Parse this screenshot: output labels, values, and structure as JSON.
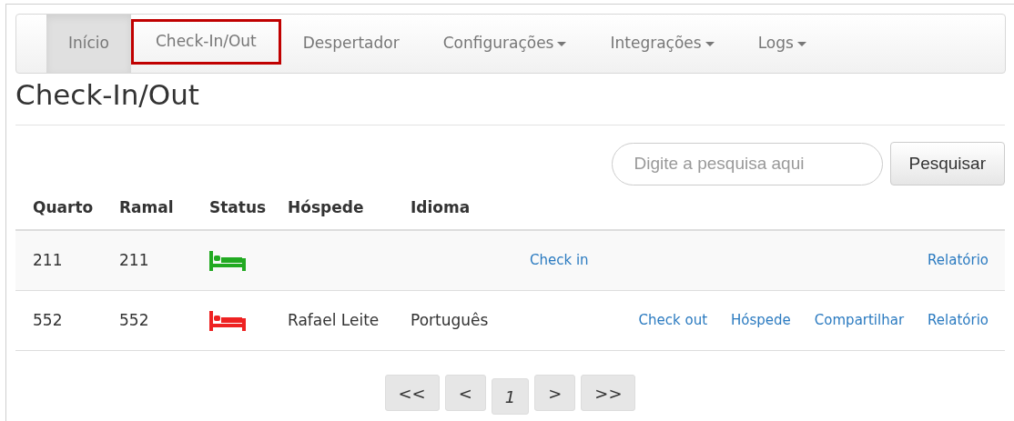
{
  "nav": [
    {
      "label": "Início",
      "selected": true,
      "highlighted": false,
      "dropdown": false
    },
    {
      "label": "Check-In/Out",
      "selected": false,
      "highlighted": true,
      "dropdown": false
    },
    {
      "label": "Despertador",
      "selected": false,
      "highlighted": false,
      "dropdown": false
    },
    {
      "label": "Configurações",
      "selected": false,
      "highlighted": false,
      "dropdown": true
    },
    {
      "label": "Integrações",
      "selected": false,
      "highlighted": false,
      "dropdown": true
    },
    {
      "label": "Logs",
      "selected": false,
      "highlighted": false,
      "dropdown": true
    }
  ],
  "page_title": "Check-In/Out",
  "search": {
    "placeholder": "Digite a pesquisa aqui",
    "button": "Pesquisar"
  },
  "table": {
    "columns": [
      "Quarto",
      "Ramal",
      "Status",
      "Hóspede",
      "Idioma"
    ],
    "rows": [
      {
        "quarto": "211",
        "ramal": "211",
        "kind": "vacant",
        "color": "#22aa22",
        "actions": [
          "Check in",
          "Relatório"
        ]
      },
      {
        "quarto": "552",
        "ramal": "552",
        "kind": "occupied",
        "color": "#ee2222",
        "guest": "Rafael Leite",
        "language": "Português",
        "actions": [
          "Check out",
          "Hóspede",
          "Compartilhar",
          "Relatório"
        ]
      }
    ]
  },
  "pagination": [
    "<<",
    "<",
    "1",
    ">",
    ">>"
  ]
}
